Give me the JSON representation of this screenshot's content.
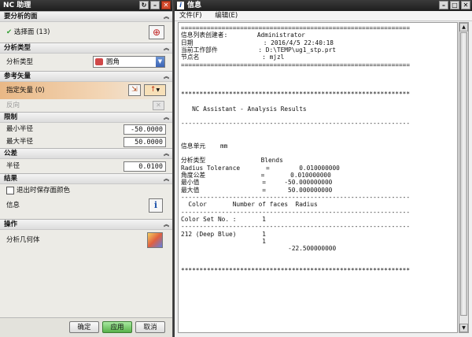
{
  "dialog": {
    "title": "NC 助理",
    "sections": {
      "face": {
        "header": "要分析的面",
        "select_label": "选择面 (13)"
      },
      "analysis_type": {
        "header": "分析类型",
        "row_label": "分析类型",
        "selected": "圆角"
      },
      "ref_vector": {
        "header": "参考矢量",
        "specify_label": "指定矢量 (0)",
        "reverse_label": "反向"
      },
      "limits": {
        "header": "限制",
        "min_label": "最小半径",
        "min_value": "-50.0000",
        "max_label": "最大半径",
        "max_value": "50.0000"
      },
      "tolerance": {
        "header": "公差",
        "radius_label": "半径",
        "radius_value": "0.0100"
      },
      "result": {
        "header": "结果",
        "keep_color_label": "退出时保存面颜色",
        "info_label": "信息"
      },
      "operation": {
        "header": "操作",
        "analyze_label": "分析几何体"
      }
    },
    "buttons": {
      "ok": "确定",
      "apply": "应用",
      "cancel": "取消"
    }
  },
  "info": {
    "title": "信息",
    "menu": [
      "文件(F)",
      "编辑(E)"
    ],
    "lines": [
      "==============================================================",
      "信息列表创建者:        Administrator",
      "日期                   : 2016/4/5 22:40:18",
      "当前工作部件           : D:\\TEMP\\ug1_stp.prt",
      "节点名                 : mjzl",
      "==============================================================",
      "",
      "",
      "",
      "**************************************************************",
      "",
      "   NC Assistant - Analysis Results",
      "",
      "--------------------------------------------------------------",
      "",
      "",
      "信息单元    mm",
      "",
      "分析类型               Blends",
      "Radius Tolerance       =        0.010000000",
      "角度公差               =       0.010000000",
      "最小值                 =     -50.000000000",
      "最大值                 =      50.000000000",
      "--------------------------------------------------------------",
      "  Color       Number of faces  Radius",
      "--------------------------------------------------------------",
      "Color Set No. :       1",
      "--------------------------------------------------------------",
      "212 (Deep Blue)       1",
      "                      1",
      "                             -22.500000000",
      "",
      "",
      "**************************************************************"
    ]
  }
}
